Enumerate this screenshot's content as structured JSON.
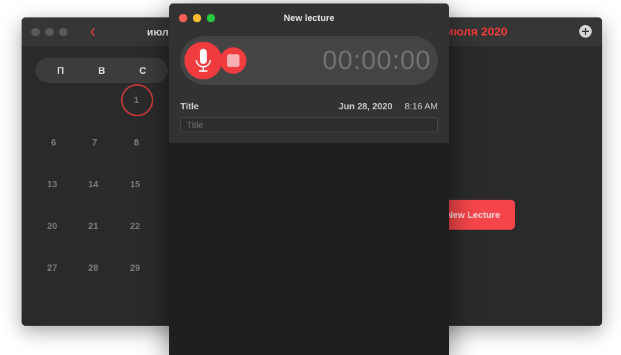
{
  "calendar_window": {
    "month_left": "июл",
    "month_right": "июля 2020",
    "weekdays": [
      "П",
      "В",
      "С"
    ],
    "days": [
      "1",
      "6",
      "7",
      "8",
      "13",
      "14",
      "15",
      "20",
      "21",
      "22",
      "27",
      "28",
      "29"
    ],
    "today": "1",
    "new_lecture_button": "New Lecture",
    "accent_color": "#f03b3f"
  },
  "recorder_window": {
    "title": "New lecture",
    "timer": "00:00:00",
    "title_label": "Title",
    "date": "Jun 28, 2020",
    "time": "8:16 AM",
    "title_placeholder": "Title"
  }
}
